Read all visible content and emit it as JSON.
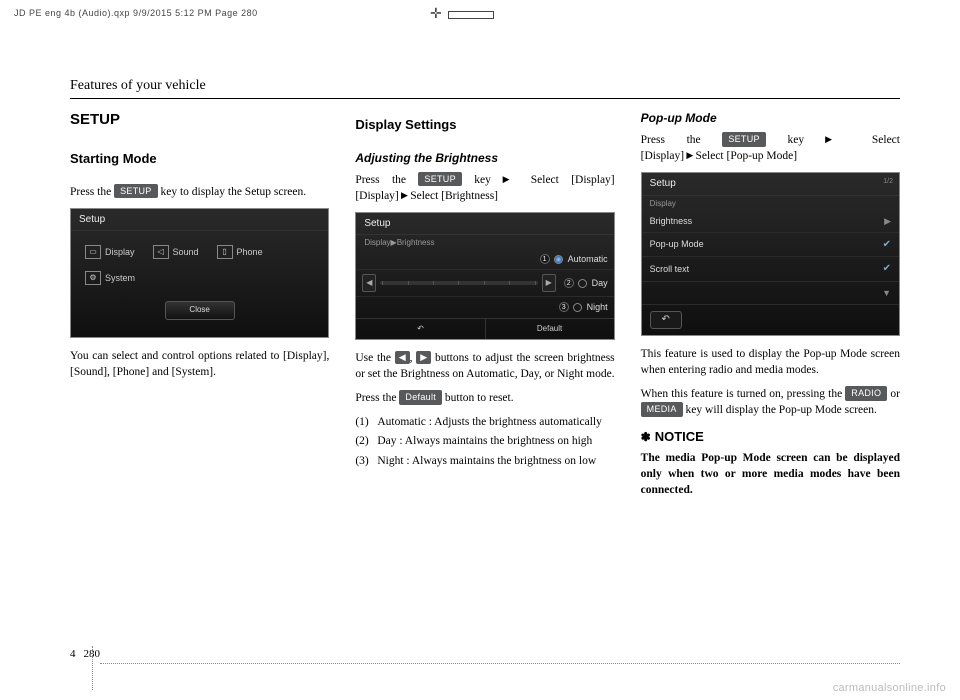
{
  "print_header": "JD PE eng 4b (Audio).qxp  9/9/2015  5:12 PM  Page 280",
  "section_header": "Features of your vehicle",
  "keys": {
    "setup": "SETUP",
    "default": "Default",
    "radio": "RADIO",
    "media": "MEDIA"
  },
  "col1": {
    "h1": "SETUP",
    "h2": "Starting Mode",
    "p1_a": "Press the ",
    "p1_b": " key to display the Setup screen.",
    "screenshot": {
      "title": "Setup",
      "items": [
        "Display",
        "Sound",
        "Phone",
        "System"
      ],
      "close": "Close"
    },
    "p2": "You can select and control options related to [Display], [Sound], [Phone] and [System]."
  },
  "col2": {
    "h2": "Display Settings",
    "h3": "Adjusting the Brightness",
    "p1_a": "Press the ",
    "p1_b": " key",
    "p1_c": "Select [Display]",
    "p1_d": "Select [Brightness]",
    "screenshot": {
      "title": "Setup",
      "crumb": "Display▶Brightness",
      "opts": [
        "Automatic",
        "Day",
        "Night"
      ],
      "back": "↶",
      "default": "Default"
    },
    "p2_a": "Use the ",
    "p2_b": ", ",
    "p2_c": " buttons to adjust the screen brightness or set the Brightness on Automatic, Day, or Night mode.",
    "p3_a": "Press the ",
    "p3_b": " button to reset.",
    "list": [
      {
        "n": "(1)",
        "t": "Automatic : Adjusts the bright­ness automatically"
      },
      {
        "n": "(2)",
        "t": "Day : Always maintains the bright­ness on high"
      },
      {
        "n": "(3)",
        "t": "Night : Always maintains the brightness on low"
      }
    ]
  },
  "col3": {
    "h3": "Pop-up Mode",
    "p1_a": "Press the ",
    "p1_b": " key",
    "p1_c": "Select [Display]",
    "p1_d": "Select [Pop-up Mode]",
    "screenshot": {
      "title": "Setup",
      "crumb": "Display",
      "page": "1/2",
      "rows": [
        {
          "label": "Brightness",
          "type": "chev"
        },
        {
          "label": "Pop-up Mode",
          "type": "check"
        },
        {
          "label": "Scroll text",
          "type": "check"
        }
      ]
    },
    "p2": "This feature is used to display the Pop-up Mode screen when entering radio and media modes.",
    "p3_a": "When this feature is turned on, pressing the ",
    "p3_b": " or ",
    "p3_c": " key will display the Pop-up Mode screen.",
    "notice_head": "NOTICE",
    "notice_body": "The media Pop-up Mode screen can be displayed only when two or more media modes have been connected."
  },
  "footer": {
    "chapter": "4",
    "page": "280"
  },
  "watermark": "carmanualsonline.info"
}
